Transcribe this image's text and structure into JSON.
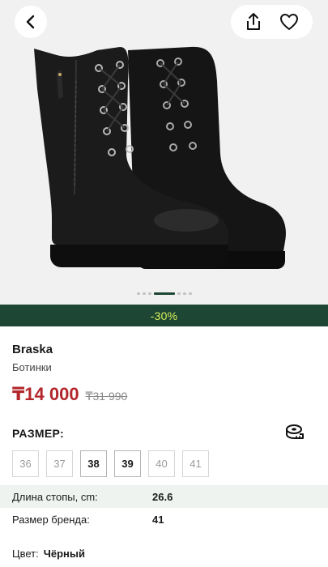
{
  "header": {
    "back_icon": "chevron-left-icon",
    "share_icon": "share-icon",
    "favorite_icon": "heart-icon"
  },
  "gallery": {
    "image_alt": "Black leather lace-up boots",
    "slide_count": 7,
    "active_slide": 3
  },
  "promo": {
    "discount": "-30%",
    "bar_color": "#1e4634",
    "text_color": "#d7f25a"
  },
  "product": {
    "brand": "Braska",
    "category": "Ботинки",
    "price": "₸14 000",
    "old_price": "₸31 990",
    "price_color": "#b3262b"
  },
  "sizes": {
    "title": "РАЗМЕР:",
    "measure_icon": "measuring-tape-icon",
    "options": [
      {
        "label": "36",
        "available": false
      },
      {
        "label": "37",
        "available": false
      },
      {
        "label": "38",
        "available": true
      },
      {
        "label": "39",
        "available": true
      },
      {
        "label": "40",
        "available": false
      },
      {
        "label": "41",
        "available": false
      }
    ]
  },
  "specs": [
    {
      "label": "Длина стопы, cm:",
      "value": "26.6"
    },
    {
      "label": "Размер бренда:",
      "value": "41"
    }
  ],
  "color": {
    "label": "Цвет:",
    "value": "Чёрный"
  }
}
